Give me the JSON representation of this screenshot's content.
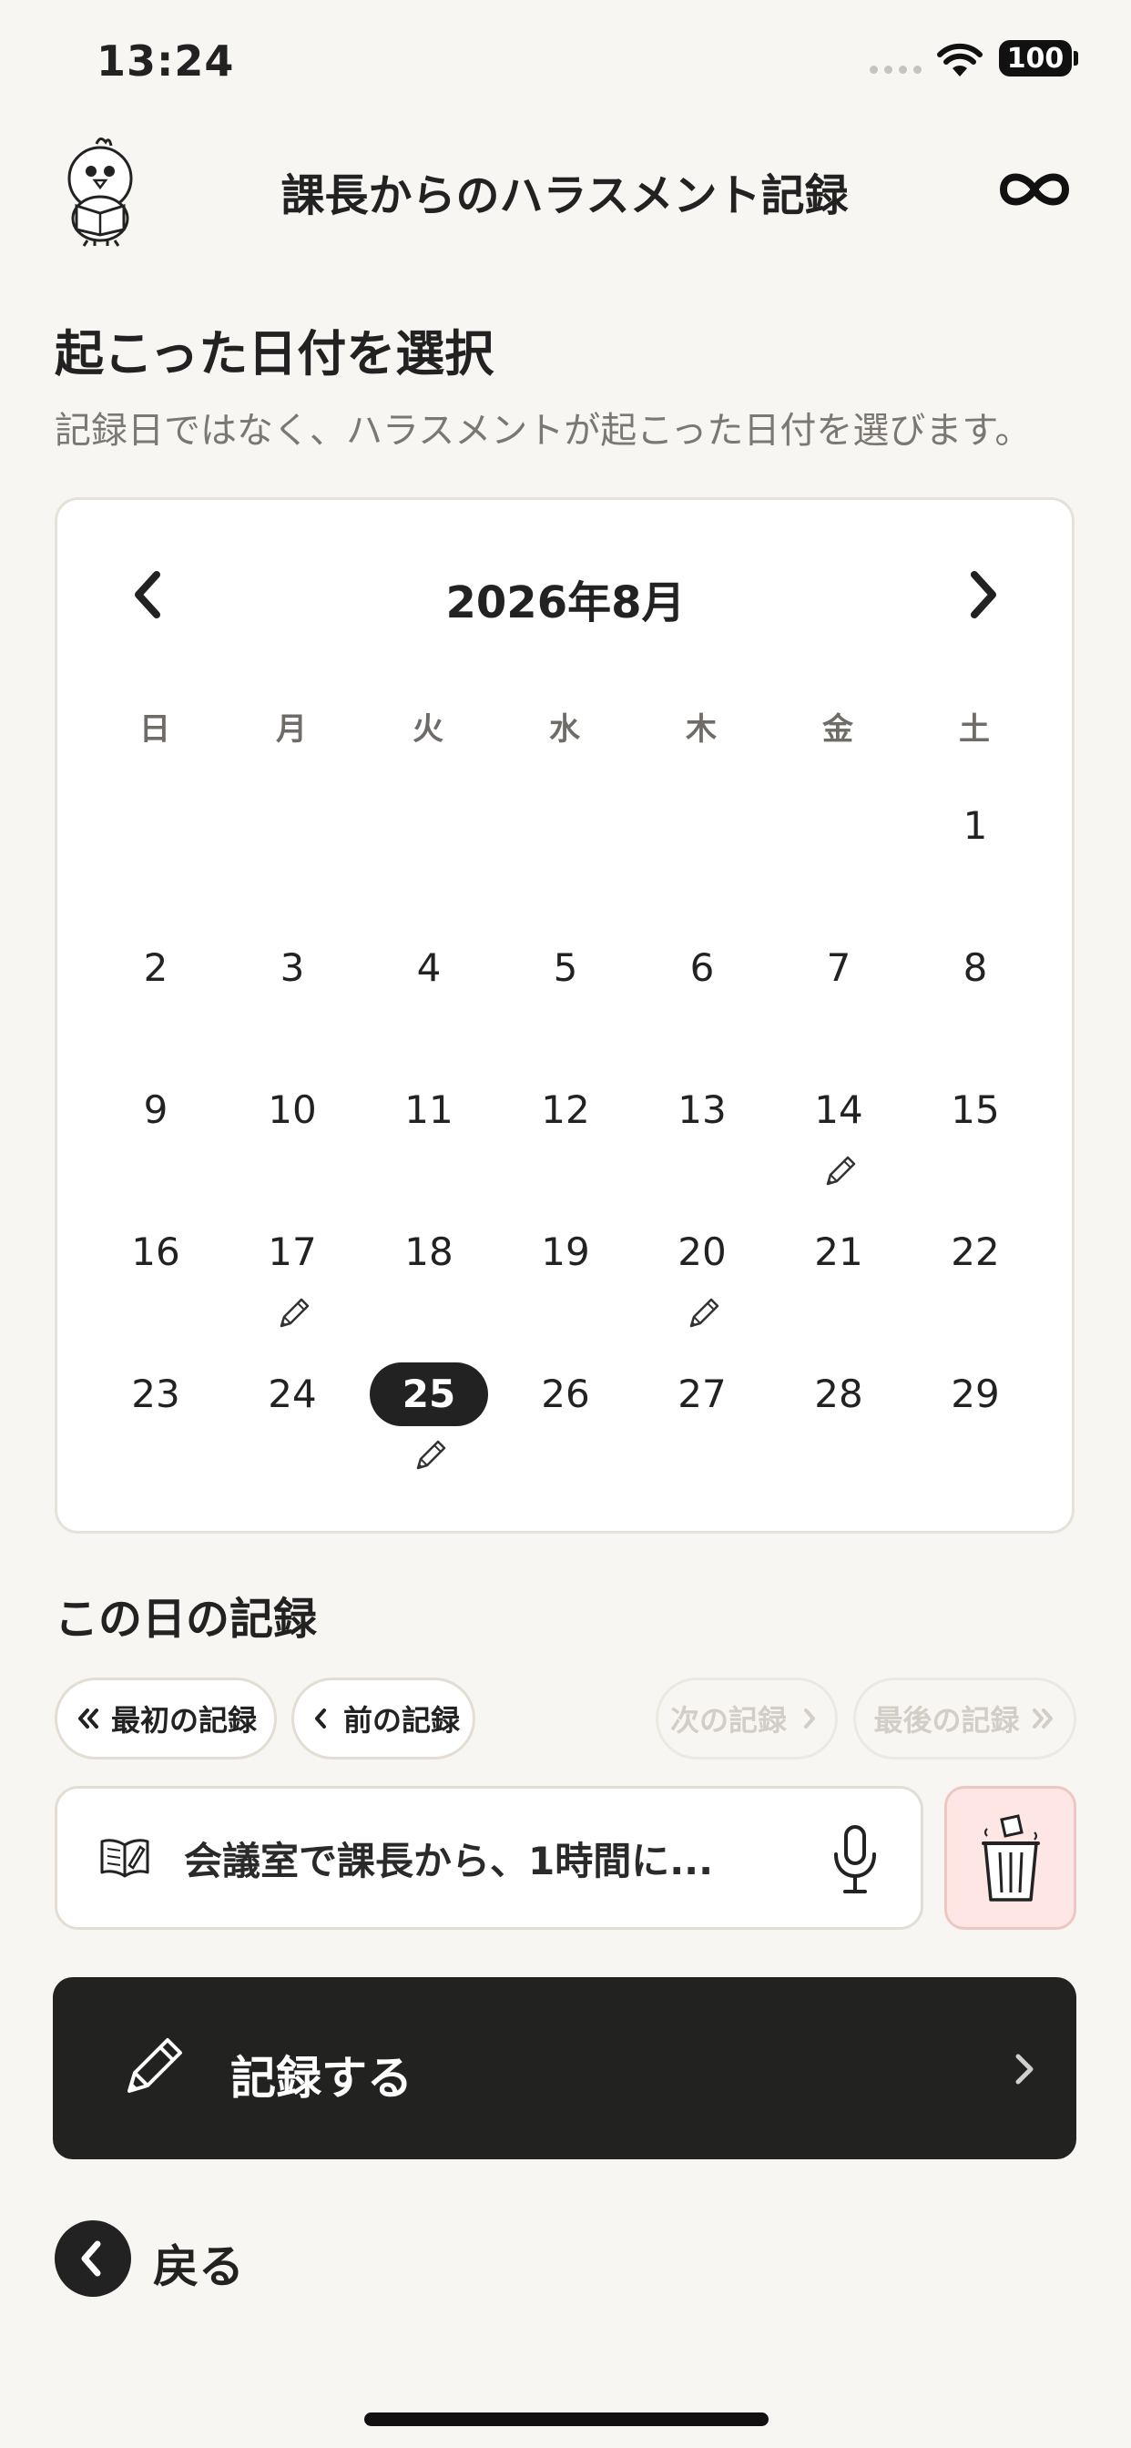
{
  "status": {
    "time": "13:24",
    "battery": "100"
  },
  "header": {
    "title": "課長からのハラスメント記録"
  },
  "date_section": {
    "title": "起こった日付を選択",
    "description": "記録日ではなく、ハラスメントが起こった日付を選びます。"
  },
  "calendar": {
    "month_label": "2026年8月",
    "weekdays": [
      "日",
      "月",
      "火",
      "水",
      "木",
      "金",
      "土"
    ],
    "days": [
      "1",
      "2",
      "3",
      "4",
      "5",
      "6",
      "7",
      "8",
      "9",
      "10",
      "11",
      "12",
      "13",
      "14",
      "15",
      "16",
      "17",
      "18",
      "19",
      "20",
      "21",
      "22",
      "23",
      "24",
      "25",
      "26",
      "27",
      "28",
      "29"
    ],
    "selected_day": "25",
    "days_with_records": [
      "14",
      "17",
      "20",
      "25"
    ]
  },
  "records": {
    "title": "この日の記録",
    "nav": {
      "first": "最初の記録",
      "prev": "前の記録",
      "next": "次の記録",
      "last": "最後の記録"
    },
    "entry_preview": "会議室で課長から、1時間に..."
  },
  "record_button": {
    "label": "記録する"
  },
  "back": {
    "label": "戻る"
  },
  "colors": {
    "dark": "#222222",
    "background": "#f8f6f2",
    "trash_bg": "#fde6e3"
  }
}
